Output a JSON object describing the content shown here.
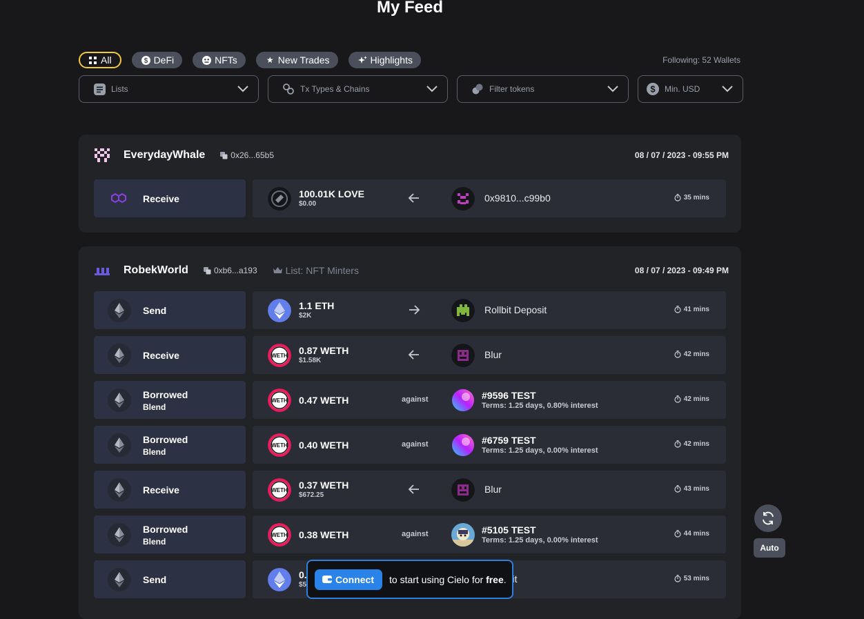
{
  "page": {
    "title": "My Feed"
  },
  "tabs": [
    {
      "label": "All",
      "icon": "grid-icon",
      "active": true
    },
    {
      "label": "DeFi",
      "icon": "dollar-icon"
    },
    {
      "label": "NFTs",
      "icon": "nft-icon"
    },
    {
      "label": "New Trades",
      "icon": "star-icon"
    },
    {
      "label": "Highlights",
      "icon": "sparkle-icon"
    }
  ],
  "following": "Following: 52 Wallets",
  "filters": [
    {
      "label": "Lists",
      "icon": "list-icon"
    },
    {
      "label": "Tx Types & Chains",
      "icon": "link-icon"
    },
    {
      "label": "Filter tokens",
      "icon": "coins-icon"
    },
    {
      "label": "Min. USD",
      "icon": "dollar-icon"
    }
  ],
  "feed": [
    {
      "wallet": "EverydayWhale",
      "address": "0x26...65b5",
      "list": "",
      "date": "08 / 07 / 2023 - 09:55 PM",
      "txs": [
        {
          "action": "Receive",
          "sub": "",
          "chain": "polygon-icon",
          "token_icon": "love-token-icon",
          "amount": "100.01K LOVE",
          "usd": "$0.00",
          "dir": "←",
          "counterparty": "0x9810...c99b0",
          "cp_icon": "pixel-avatar-icon",
          "nft_title": "",
          "nft_id": "",
          "nft_terms": "",
          "time": "35 mins"
        }
      ]
    },
    {
      "wallet": "RobekWorld",
      "address": "0xb6...a193",
      "list": "List: NFT Minters",
      "date": "08 / 07 / 2023 - 09:49 PM",
      "txs": [
        {
          "action": "Send",
          "sub": "",
          "chain": "ethereum-icon",
          "token_icon": "eth-token-icon",
          "amount": "1.1 ETH",
          "usd": "$2K",
          "dir": "→",
          "counterparty": "Rollbit Deposit",
          "cp_icon": "rollbit-icon",
          "time": "41 mins"
        },
        {
          "action": "Receive",
          "sub": "",
          "chain": "ethereum-icon",
          "token_icon": "weth-token-icon",
          "amount": "0.87 WETH",
          "usd": "$1.58K",
          "dir": "←",
          "counterparty": "Blur",
          "cp_icon": "blur-icon",
          "time": "42 mins"
        },
        {
          "action": "Borrowed",
          "sub": "Blend",
          "chain": "ethereum-icon",
          "token_icon": "weth-token-icon",
          "amount": "0.47 WETH",
          "usd": "",
          "dir": "against",
          "nft_id": "#9596",
          "nft_title": "TEST",
          "nft_terms": "Terms: 1.25 days, 0.80% interest",
          "cp_icon": "nft-gradient-icon",
          "time": "42 mins"
        },
        {
          "action": "Borrowed",
          "sub": "Blend",
          "chain": "ethereum-icon",
          "token_icon": "weth-token-icon",
          "amount": "0.40 WETH",
          "usd": "",
          "dir": "against",
          "nft_id": "#6759",
          "nft_title": "TEST",
          "nft_terms": "Terms: 1.25 days, 0.00% interest",
          "cp_icon": "nft-gradient-icon",
          "time": "42 mins"
        },
        {
          "action": "Receive",
          "sub": "",
          "chain": "ethereum-icon",
          "token_icon": "weth-token-icon",
          "amount": "0.37 WETH",
          "usd": "$672.25",
          "dir": "←",
          "counterparty": "Blur",
          "cp_icon": "blur-icon",
          "time": "43 mins"
        },
        {
          "action": "Borrowed",
          "sub": "Blend",
          "chain": "ethereum-icon",
          "token_icon": "weth-token-icon",
          "amount": "0.38 WETH",
          "usd": "",
          "dir": "against",
          "nft_id": "#5105",
          "nft_title": "TEST",
          "nft_terms": "Terms: 1.25 days, 0.00% interest",
          "cp_icon": "nft-image-icon",
          "time": "44 mins"
        },
        {
          "action": "Send",
          "sub": "",
          "chain": "ethereum-icon",
          "token_icon": "eth-token-icon",
          "amount": "0.",
          "usd": "$5",
          "dir": "→",
          "counterparty": "Deposit",
          "cp_icon": "rollbit-icon",
          "time": "53 mins"
        }
      ]
    }
  ],
  "side": {
    "refresh_icon": "refresh-icon",
    "auto_label": "Auto"
  },
  "connect": {
    "button": "Connect",
    "text_before": "to start using Cielo for",
    "text_bold": "free",
    "text_after": "."
  },
  "colors": {
    "accent_chip_border": "#f3c940",
    "connect_blue": "#2a83e8",
    "card_bg": "#222327"
  }
}
